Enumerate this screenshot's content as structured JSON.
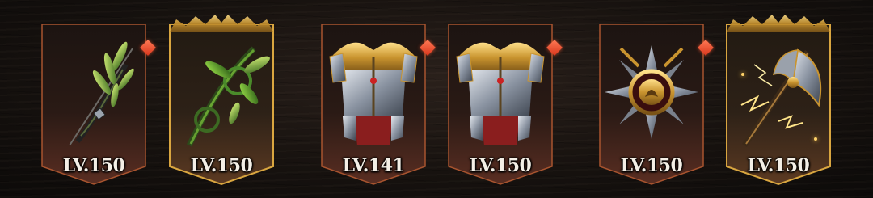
{
  "equipment_slots": [
    {
      "item": "green leaf bow",
      "quality": "red",
      "level_label": "LV.150",
      "upgrade_gem": true,
      "gold_crest": false
    },
    {
      "item": "vine bow",
      "quality": "legendary",
      "level_label": "LV.150",
      "upgrade_gem": false,
      "gold_crest": true
    },
    {
      "item": "steel chest armor",
      "quality": "red",
      "level_label": "LV.141",
      "upgrade_gem": true,
      "gold_crest": false
    },
    {
      "item": "steel chest armor",
      "quality": "red",
      "level_label": "LV.150",
      "upgrade_gem": true,
      "gold_crest": false
    },
    {
      "item": "medal emblem",
      "quality": "red",
      "level_label": "LV.150",
      "upgrade_gem": true,
      "gold_crest": false
    },
    {
      "item": "lightning axe",
      "quality": "legendary",
      "level_label": "LV.150",
      "upgrade_gem": false,
      "gold_crest": true
    }
  ],
  "colors": {
    "frame_red": "#a8542f",
    "frame_gold": "#d9a640",
    "gem": "#e5482a",
    "label": "#f4efe6"
  }
}
